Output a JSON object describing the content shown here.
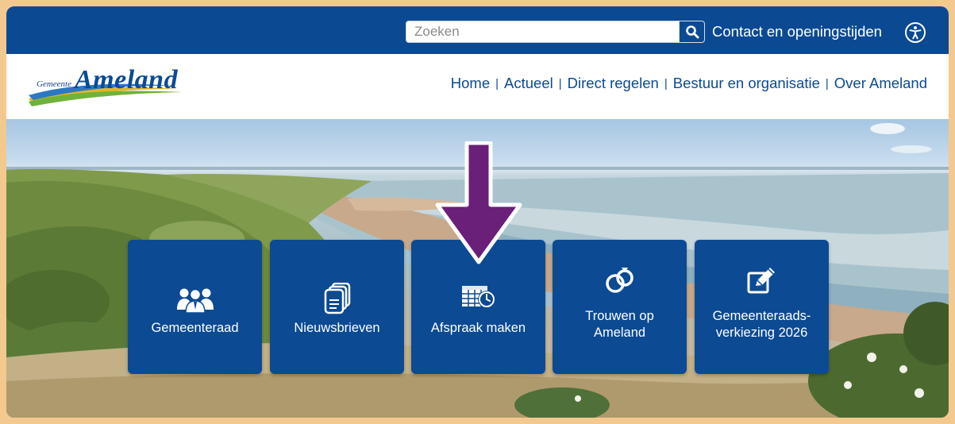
{
  "search": {
    "placeholder": "Zoeken",
    "value": ""
  },
  "topbar": {
    "contact_label": "Contact en openingstijden"
  },
  "logo": {
    "small_text": "Gemeente",
    "big_text": "Ameland"
  },
  "nav": {
    "items": [
      {
        "label": "Home"
      },
      {
        "label": "Actueel"
      },
      {
        "label": "Direct regelen"
      },
      {
        "label": "Bestuur en organisatie"
      },
      {
        "label": "Over Ameland"
      }
    ],
    "separator": "|"
  },
  "tiles": [
    {
      "label": "Gemeenteraad",
      "icon": "council-people-icon"
    },
    {
      "label": "Nieuwsbrieven",
      "icon": "newsletter-documents-icon"
    },
    {
      "label": "Afspraak maken",
      "icon": "calendar-clock-icon"
    },
    {
      "label": "Trouwen op Ameland",
      "line1": "Trouwen op",
      "line2": "Ameland",
      "icon": "wedding-rings-icon"
    },
    {
      "label": "Gemeenteraads-verkiezing 2026",
      "line1": "Gemeenteraads-",
      "line2": "verkiezing 2026",
      "icon": "ballot-pencil-icon"
    }
  ],
  "colors": {
    "brand_blue": "#0b4a93",
    "arrow_purple": "#6a1f78",
    "frame_border": "#f4c98f"
  }
}
